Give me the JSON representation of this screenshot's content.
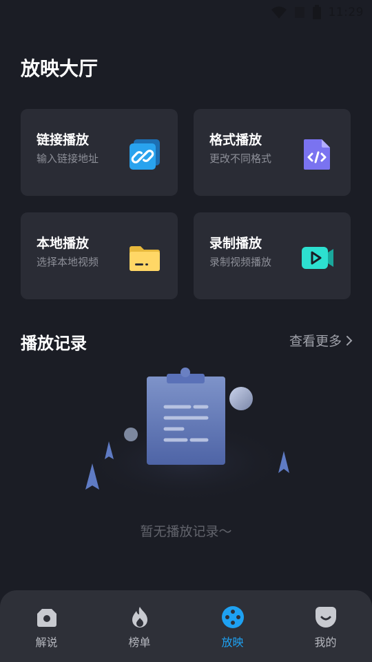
{
  "status_bar": {
    "time": "11:29"
  },
  "page_title": "放映大厅",
  "cards": [
    {
      "title": "链接播放",
      "subtitle": "输入链接地址",
      "icon": "link-icon",
      "color": "#29a3ee"
    },
    {
      "title": "格式播放",
      "subtitle": "更改不同格式",
      "icon": "code-file-icon",
      "color": "#7a73f0"
    },
    {
      "title": "本地播放",
      "subtitle": "选择本地视频",
      "icon": "folder-icon",
      "color": "#ffd15a"
    },
    {
      "title": "录制播放",
      "subtitle": "录制视频播放",
      "icon": "video-record-icon",
      "color": "#2de0d0"
    }
  ],
  "history": {
    "title": "播放记录",
    "see_more": "查看更多",
    "empty_text": "暂无播放记录～"
  },
  "tabbar": {
    "tabs": [
      {
        "label": "解说",
        "icon": "camera-icon",
        "active": false
      },
      {
        "label": "榜单",
        "icon": "fire-icon",
        "active": false
      },
      {
        "label": "放映",
        "icon": "film-reel-icon",
        "active": true
      },
      {
        "label": "我的",
        "icon": "smile-icon",
        "active": false
      }
    ]
  },
  "colors": {
    "background": "#1b1d25",
    "card": "#2a2c35",
    "accent": "#1ea1f2",
    "tabbar": "#2e3038"
  }
}
